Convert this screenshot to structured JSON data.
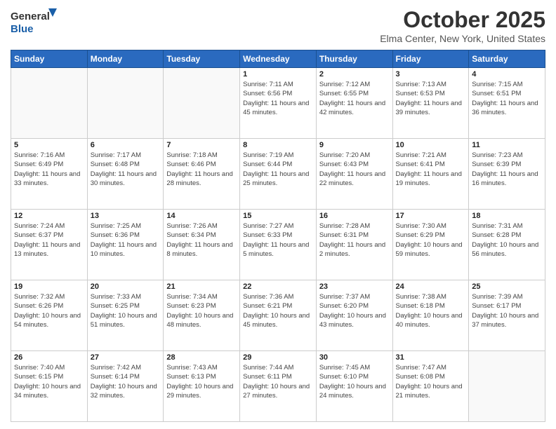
{
  "header": {
    "logo_general": "General",
    "logo_blue": "Blue",
    "month": "October 2025",
    "location": "Elma Center, New York, United States"
  },
  "days_of_week": [
    "Sunday",
    "Monday",
    "Tuesday",
    "Wednesday",
    "Thursday",
    "Friday",
    "Saturday"
  ],
  "weeks": [
    [
      {
        "day": "",
        "info": ""
      },
      {
        "day": "",
        "info": ""
      },
      {
        "day": "",
        "info": ""
      },
      {
        "day": "1",
        "info": "Sunrise: 7:11 AM\nSunset: 6:56 PM\nDaylight: 11 hours and 45 minutes."
      },
      {
        "day": "2",
        "info": "Sunrise: 7:12 AM\nSunset: 6:55 PM\nDaylight: 11 hours and 42 minutes."
      },
      {
        "day": "3",
        "info": "Sunrise: 7:13 AM\nSunset: 6:53 PM\nDaylight: 11 hours and 39 minutes."
      },
      {
        "day": "4",
        "info": "Sunrise: 7:15 AM\nSunset: 6:51 PM\nDaylight: 11 hours and 36 minutes."
      }
    ],
    [
      {
        "day": "5",
        "info": "Sunrise: 7:16 AM\nSunset: 6:49 PM\nDaylight: 11 hours and 33 minutes."
      },
      {
        "day": "6",
        "info": "Sunrise: 7:17 AM\nSunset: 6:48 PM\nDaylight: 11 hours and 30 minutes."
      },
      {
        "day": "7",
        "info": "Sunrise: 7:18 AM\nSunset: 6:46 PM\nDaylight: 11 hours and 28 minutes."
      },
      {
        "day": "8",
        "info": "Sunrise: 7:19 AM\nSunset: 6:44 PM\nDaylight: 11 hours and 25 minutes."
      },
      {
        "day": "9",
        "info": "Sunrise: 7:20 AM\nSunset: 6:43 PM\nDaylight: 11 hours and 22 minutes."
      },
      {
        "day": "10",
        "info": "Sunrise: 7:21 AM\nSunset: 6:41 PM\nDaylight: 11 hours and 19 minutes."
      },
      {
        "day": "11",
        "info": "Sunrise: 7:23 AM\nSunset: 6:39 PM\nDaylight: 11 hours and 16 minutes."
      }
    ],
    [
      {
        "day": "12",
        "info": "Sunrise: 7:24 AM\nSunset: 6:37 PM\nDaylight: 11 hours and 13 minutes."
      },
      {
        "day": "13",
        "info": "Sunrise: 7:25 AM\nSunset: 6:36 PM\nDaylight: 11 hours and 10 minutes."
      },
      {
        "day": "14",
        "info": "Sunrise: 7:26 AM\nSunset: 6:34 PM\nDaylight: 11 hours and 8 minutes."
      },
      {
        "day": "15",
        "info": "Sunrise: 7:27 AM\nSunset: 6:33 PM\nDaylight: 11 hours and 5 minutes."
      },
      {
        "day": "16",
        "info": "Sunrise: 7:28 AM\nSunset: 6:31 PM\nDaylight: 11 hours and 2 minutes."
      },
      {
        "day": "17",
        "info": "Sunrise: 7:30 AM\nSunset: 6:29 PM\nDaylight: 10 hours and 59 minutes."
      },
      {
        "day": "18",
        "info": "Sunrise: 7:31 AM\nSunset: 6:28 PM\nDaylight: 10 hours and 56 minutes."
      }
    ],
    [
      {
        "day": "19",
        "info": "Sunrise: 7:32 AM\nSunset: 6:26 PM\nDaylight: 10 hours and 54 minutes."
      },
      {
        "day": "20",
        "info": "Sunrise: 7:33 AM\nSunset: 6:25 PM\nDaylight: 10 hours and 51 minutes."
      },
      {
        "day": "21",
        "info": "Sunrise: 7:34 AM\nSunset: 6:23 PM\nDaylight: 10 hours and 48 minutes."
      },
      {
        "day": "22",
        "info": "Sunrise: 7:36 AM\nSunset: 6:21 PM\nDaylight: 10 hours and 45 minutes."
      },
      {
        "day": "23",
        "info": "Sunrise: 7:37 AM\nSunset: 6:20 PM\nDaylight: 10 hours and 43 minutes."
      },
      {
        "day": "24",
        "info": "Sunrise: 7:38 AM\nSunset: 6:18 PM\nDaylight: 10 hours and 40 minutes."
      },
      {
        "day": "25",
        "info": "Sunrise: 7:39 AM\nSunset: 6:17 PM\nDaylight: 10 hours and 37 minutes."
      }
    ],
    [
      {
        "day": "26",
        "info": "Sunrise: 7:40 AM\nSunset: 6:15 PM\nDaylight: 10 hours and 34 minutes."
      },
      {
        "day": "27",
        "info": "Sunrise: 7:42 AM\nSunset: 6:14 PM\nDaylight: 10 hours and 32 minutes."
      },
      {
        "day": "28",
        "info": "Sunrise: 7:43 AM\nSunset: 6:13 PM\nDaylight: 10 hours and 29 minutes."
      },
      {
        "day": "29",
        "info": "Sunrise: 7:44 AM\nSunset: 6:11 PM\nDaylight: 10 hours and 27 minutes."
      },
      {
        "day": "30",
        "info": "Sunrise: 7:45 AM\nSunset: 6:10 PM\nDaylight: 10 hours and 24 minutes."
      },
      {
        "day": "31",
        "info": "Sunrise: 7:47 AM\nSunset: 6:08 PM\nDaylight: 10 hours and 21 minutes."
      },
      {
        "day": "",
        "info": ""
      }
    ]
  ]
}
